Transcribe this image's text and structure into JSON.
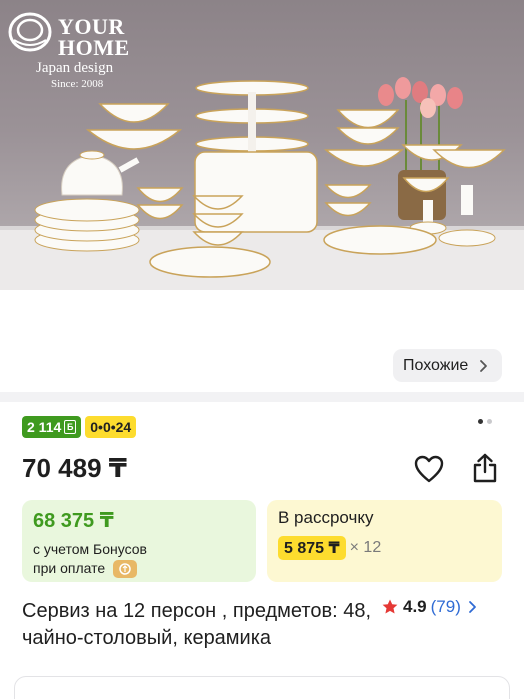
{
  "brand": {
    "line1": "YOUR",
    "line2": "HOME",
    "line3": "Japan design",
    "line4": "Since: 2008"
  },
  "similar": {
    "label": "Похожие"
  },
  "badges": {
    "bonus_amount": "2 114",
    "bonus_coin": "Б",
    "installment_code": "0•0•24"
  },
  "gallery": {
    "total": 2,
    "active_index": 1
  },
  "price": {
    "main": "70 489 ₸"
  },
  "bonus_card": {
    "price": "68 375 ₸",
    "line1": "с учетом Бонусов",
    "line2": "при оплате"
  },
  "installment_card": {
    "label": "В рассрочку",
    "amount": "5 875 ₸",
    "multiplier": "× 12"
  },
  "product": {
    "title": "Сервиз на 12 персон , предметов: 48, чайно-столовый, керамика",
    "rating": "4.9",
    "reviews": "(79)"
  },
  "colors": {
    "bonus_green": "#3f9a1f",
    "highlight_yellow": "#fddc2e",
    "rating_star": "#e53935",
    "link_blue": "#2f6bd4"
  },
  "icons": [
    "plate-stack-logo-icon",
    "chevron-right-icon",
    "coin-icon",
    "heart-icon",
    "share-icon",
    "wallet-icon",
    "star-icon"
  ]
}
